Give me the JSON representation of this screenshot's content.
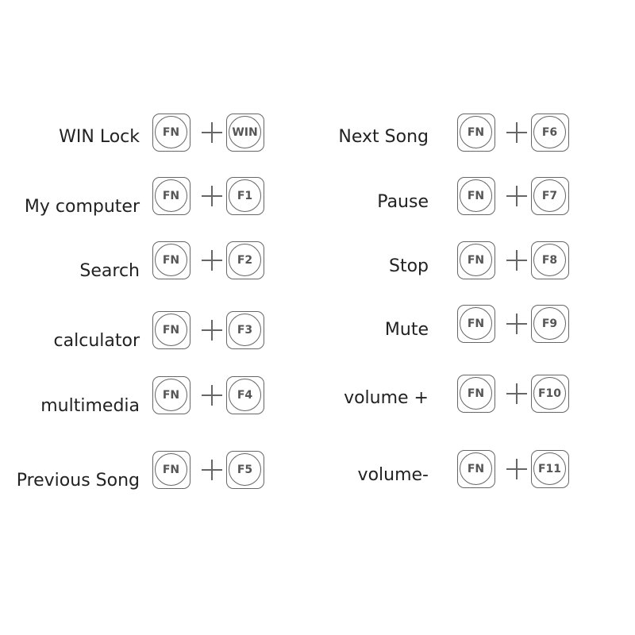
{
  "left": [
    {
      "label": "WIN Lock",
      "key1": "FN",
      "key2": "WIN"
    },
    {
      "label": "My computer",
      "key1": "FN",
      "key2": "F1"
    },
    {
      "label": "Search",
      "key1": "FN",
      "key2": "F2"
    },
    {
      "label": "calculator",
      "key1": "FN",
      "key2": "F3"
    },
    {
      "label": "multimedia",
      "key1": "FN",
      "key2": "F4"
    },
    {
      "label": "Previous Song",
      "key1": "FN",
      "key2": "F5"
    }
  ],
  "right": [
    {
      "label": "Next Song",
      "key1": "FN",
      "key2": "F6"
    },
    {
      "label": "Pause",
      "key1": "FN",
      "key2": "F7"
    },
    {
      "label": "Stop",
      "key1": "FN",
      "key2": "F8"
    },
    {
      "label": "Mute",
      "key1": "FN",
      "key2": "F9"
    },
    {
      "label": "volume +",
      "key1": "FN",
      "key2": "F10"
    },
    {
      "label": "volume-",
      "key1": "FN",
      "key2": "F11"
    }
  ]
}
